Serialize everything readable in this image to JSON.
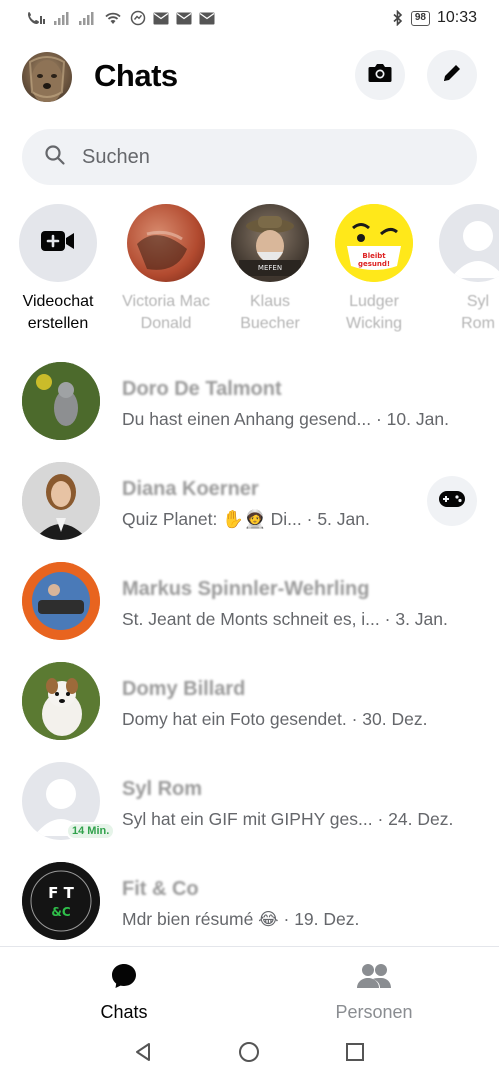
{
  "status_bar": {
    "time": "10:33",
    "battery": "98",
    "icons_left": [
      "call-icon",
      "signal-icon",
      "signal-icon",
      "wifi-icon",
      "messenger-icon",
      "mail-icon",
      "mail-icon",
      "mail-icon"
    ],
    "icons_right": [
      "bluetooth-icon",
      "battery-icon"
    ]
  },
  "header": {
    "title": "Chats",
    "camera_icon": "camera-icon",
    "compose_icon": "edit-icon"
  },
  "search": {
    "placeholder": "Suchen"
  },
  "stories": [
    {
      "label": "Videochat\nerstellen",
      "type": "create",
      "icon": "video-plus-icon"
    },
    {
      "label": "Victoria Mac\nDonald",
      "type": "user"
    },
    {
      "label": "Klaus\nBuecher",
      "type": "user"
    },
    {
      "label": "Ludger\nWicking",
      "type": "user",
      "sticker_text": "Bleibt\ngesund!"
    },
    {
      "label": "Syl\nRom",
      "type": "user"
    }
  ],
  "chats": [
    {
      "name": "Doro De Talmont",
      "preview": "Du hast einen Anhang gesend...",
      "date": "· 10. Jan."
    },
    {
      "name": "Diana Koerner",
      "preview": "Quiz Planet: ✋🧑‍🚀 Di...",
      "date": "· 5. Jan.",
      "action_icon": "gamepad-icon"
    },
    {
      "name": "Markus Spinnler-Wehrling",
      "preview": "St. Jeant de Monts schneit es, i...",
      "date": "· 3. Jan."
    },
    {
      "name": "Domy Billard",
      "preview": "Domy hat ein Foto gesendet.",
      "date": "· 30. Dez."
    },
    {
      "name": "Syl Rom",
      "preview": "Syl hat ein GIF mit GIPHY ges...",
      "date": "· 24. Dez.",
      "badge": "14 Min."
    },
    {
      "name": "Fit & Co",
      "preview": "Mdr bien résumé 😂",
      "date": "· 19. Dez."
    }
  ],
  "bottom_nav": {
    "tabs": [
      {
        "label": "Chats",
        "icon": "chat-bubble-icon",
        "active": true
      },
      {
        "label": "Personen",
        "icon": "people-icon",
        "active": false
      }
    ]
  },
  "system_nav": [
    "back-icon",
    "home-icon",
    "recents-icon"
  ],
  "colors": {
    "accent": "#050505",
    "muted": "#65676b",
    "surface": "#f0f2f5",
    "online": "#31a24c"
  }
}
